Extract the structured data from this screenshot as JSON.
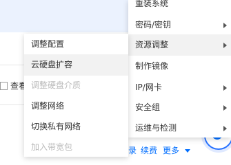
{
  "background": {
    "partial_label": "查看"
  },
  "parent_menu": {
    "items": [
      {
        "label": "重装系统",
        "has_submenu": false,
        "state": "normal"
      },
      {
        "label": "密码/密钥",
        "has_submenu": true,
        "state": "normal"
      },
      {
        "label": "资源调整",
        "has_submenu": true,
        "state": "active"
      },
      {
        "label": "制作镜像",
        "has_submenu": false,
        "state": "normal"
      },
      {
        "label": "IP/网卡",
        "has_submenu": true,
        "state": "normal"
      },
      {
        "label": "安全组",
        "has_submenu": true,
        "state": "normal"
      },
      {
        "label": "运维与检测",
        "has_submenu": true,
        "state": "normal"
      }
    ]
  },
  "sub_menu": {
    "items": [
      {
        "label": "调整配置",
        "state": "normal"
      },
      {
        "label": "云硬盘扩容",
        "state": "active"
      },
      {
        "label": "调整硬盘介质",
        "state": "disabled"
      },
      {
        "label": "调整网络",
        "state": "normal"
      },
      {
        "label": "切换私有网络",
        "state": "normal"
      },
      {
        "label": "加入带宽包",
        "state": "disabled"
      }
    ]
  },
  "action_bar": {
    "partial_link": "录",
    "renew_label": "续费",
    "more_label": "更多"
  },
  "colors": {
    "link": "#006eff",
    "disabled_text": "#bbbbbb",
    "active_bg": "#f2f2f2",
    "header_band": "#ebf2fe"
  },
  "icons": {
    "submenu_arrow": "caret-right-icon",
    "more_caret": "caret-down-icon",
    "float_button": "refresh-icon"
  }
}
